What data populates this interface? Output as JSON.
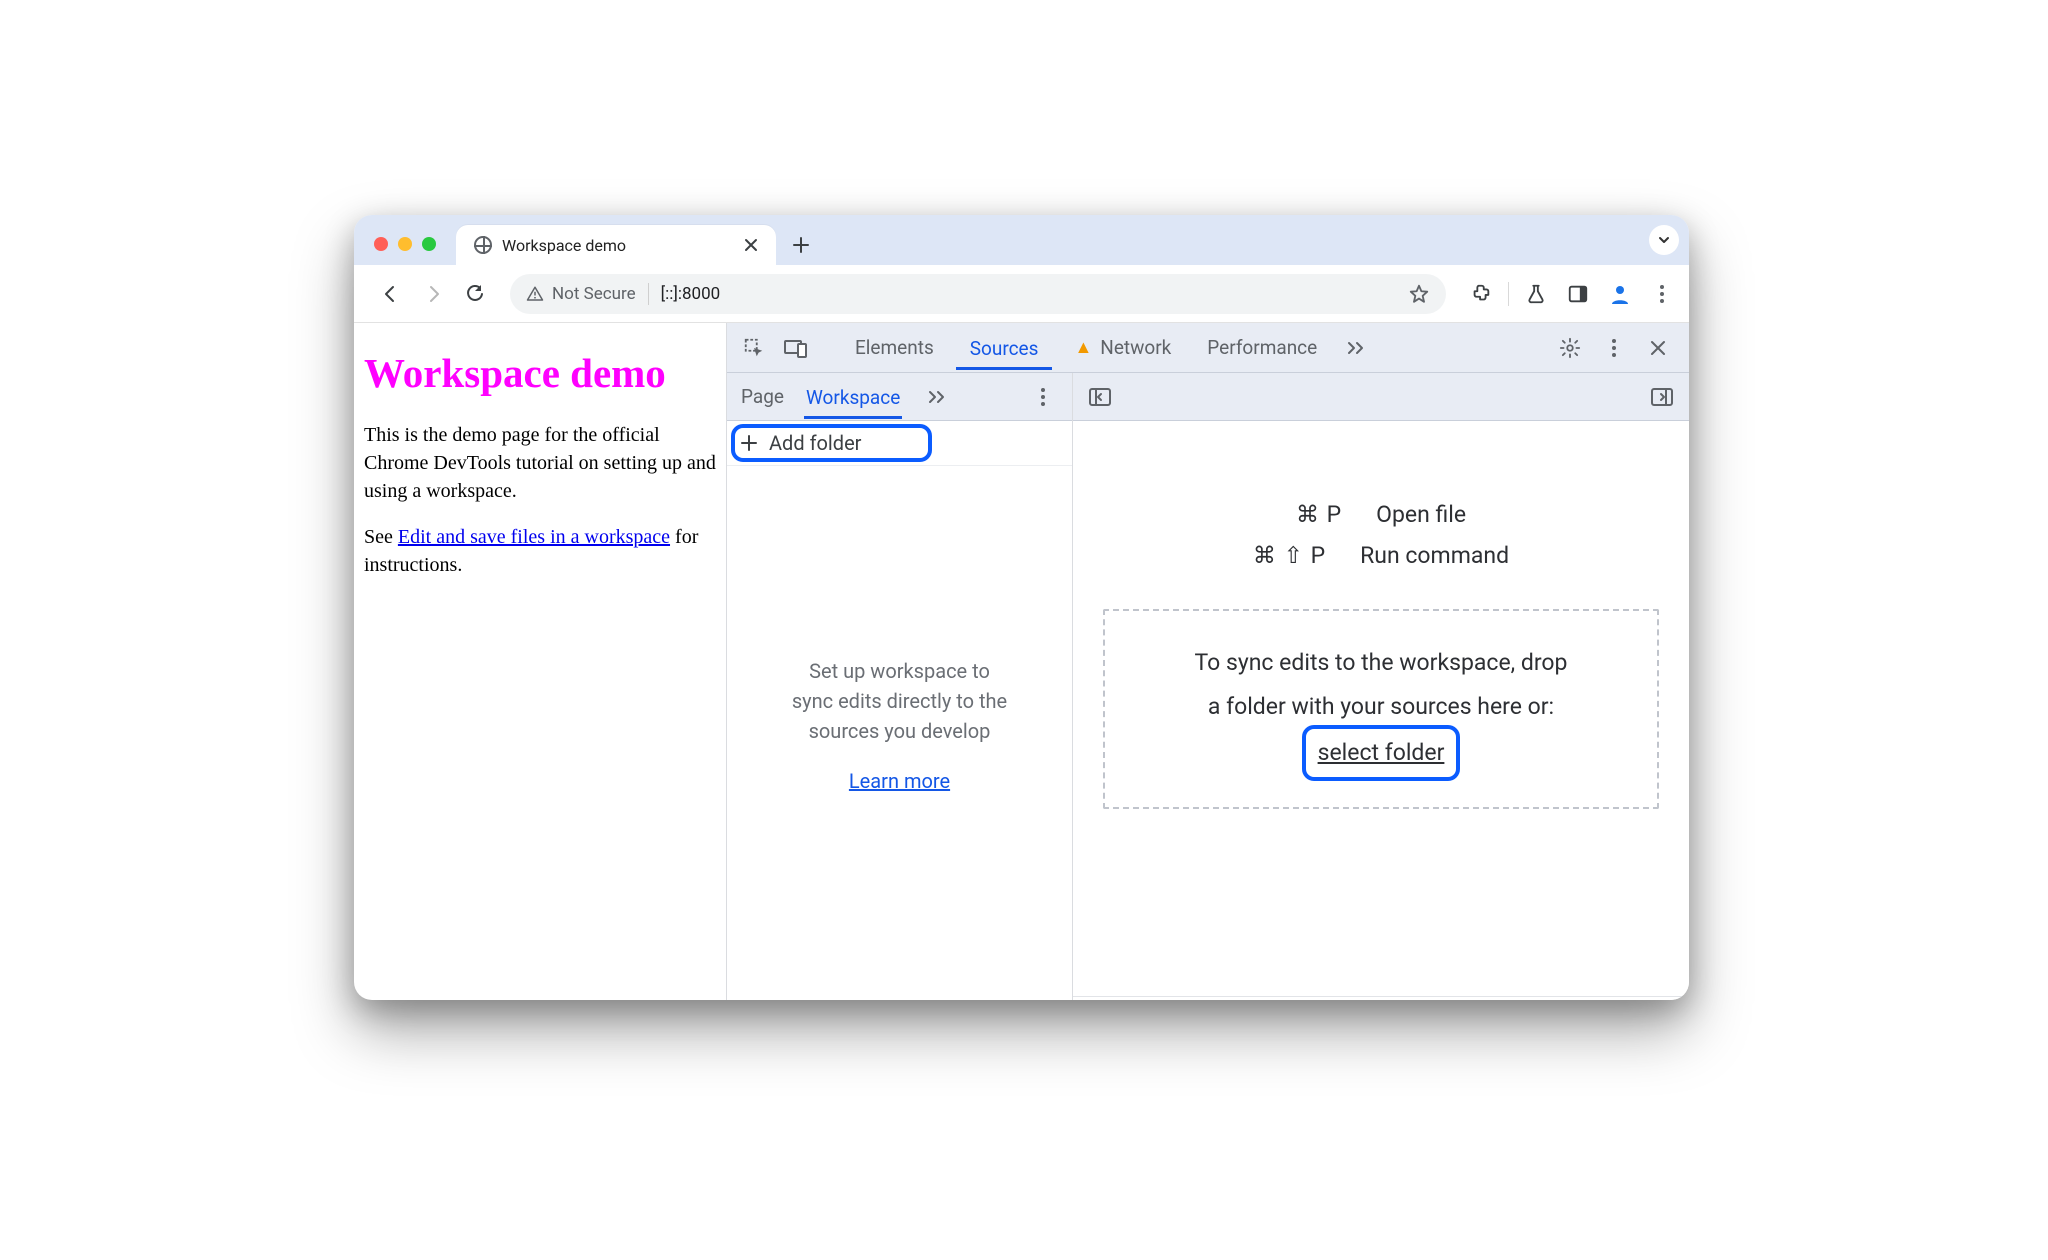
{
  "tab": {
    "title": "Workspace demo"
  },
  "omnibox": {
    "secure_label": "Not Secure",
    "url": "[::]:8000"
  },
  "page": {
    "h1": "Workspace demo",
    "p1": "This is the demo page for the official Chrome DevTools tutorial on setting up and using a workspace.",
    "p2_pre": "See ",
    "p2_link": "Edit and save files in a workspace",
    "p2_post": " for instructions."
  },
  "devtools": {
    "tabs": {
      "elements": "Elements",
      "sources": "Sources",
      "network": "Network",
      "performance": "Performance"
    },
    "active_tab": "Sources",
    "nav_tabs": {
      "page": "Page",
      "workspace": "Workspace"
    },
    "active_nav_tab": "Workspace",
    "add_folder": "Add folder",
    "nav_empty": {
      "l1": "Set up workspace to",
      "l2": "sync edits directly to the",
      "l3": "sources you develop",
      "learn_more": "Learn more"
    },
    "shortcuts": {
      "openfile": {
        "keys": "⌘ P",
        "label": "Open file"
      },
      "runcommand": {
        "keys": "⌘ ⇧ P",
        "label": "Run command"
      }
    },
    "dropzone": {
      "l1": "To sync edits to the workspace, drop",
      "l2": "a folder with your sources here or:",
      "select": "select folder"
    }
  }
}
